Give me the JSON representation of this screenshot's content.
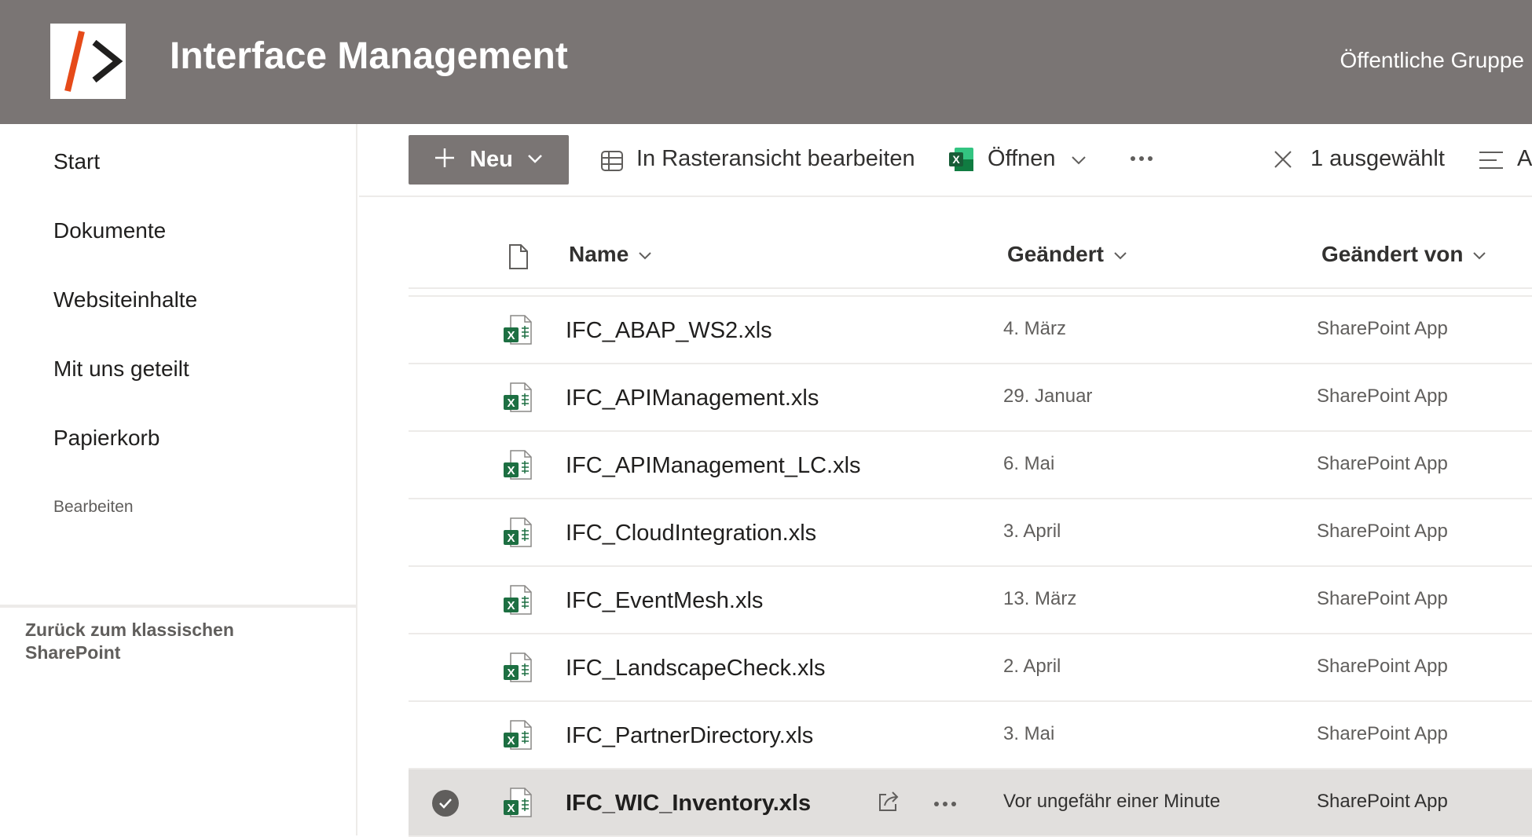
{
  "header": {
    "title": "Interface Management",
    "group_label": "Öffentliche Gruppe",
    "logo_icon": "site-logo-slash-chevron",
    "brand_color": "#7a7574",
    "logo_accent_color": "#e64a19"
  },
  "nav": {
    "items": [
      {
        "label": "Start"
      },
      {
        "label": "Dokumente"
      },
      {
        "label": "Websiteinhalte"
      },
      {
        "label": "Mit uns geteilt"
      },
      {
        "label": "Papierkorb"
      }
    ],
    "edit_label": "Bearbeiten",
    "classic_link": "Zurück zum klassischen SharePoint"
  },
  "commandbar": {
    "new_label": "Neu",
    "grid_edit_label": "In Rasteransicht bearbeiten",
    "open_label": "Öffnen",
    "more_icon": "ellipsis-icon",
    "selected_label": "1 ausgewählt",
    "view_label": "Al"
  },
  "columns": {
    "type_icon": "document-icon",
    "name": "Name",
    "modified": "Geändert",
    "modified_by": "Geändert von"
  },
  "files": [
    {
      "name": "IFC_ABAP_WS2.xls",
      "modified": "4. März",
      "modified_by": "SharePoint App",
      "selected": false
    },
    {
      "name": "IFC_APIManagement.xls",
      "modified": "29. Januar",
      "modified_by": "SharePoint App",
      "selected": false
    },
    {
      "name": "IFC_APIManagement_LC.xls",
      "modified": "6. Mai",
      "modified_by": "SharePoint App",
      "selected": false
    },
    {
      "name": "IFC_CloudIntegration.xls",
      "modified": "3. April",
      "modified_by": "SharePoint App",
      "selected": false
    },
    {
      "name": "IFC_EventMesh.xls",
      "modified": "13. März",
      "modified_by": "SharePoint App",
      "selected": false
    },
    {
      "name": "IFC_LandscapeCheck.xls",
      "modified": "2. April",
      "modified_by": "SharePoint App",
      "selected": false
    },
    {
      "name": "IFC_PartnerDirectory.xls",
      "modified": "3. Mai",
      "modified_by": "SharePoint App",
      "selected": false
    },
    {
      "name": "IFC_WIC_Inventory.xls",
      "modified": "Vor ungefähr einer Minute",
      "modified_by": "SharePoint App",
      "selected": true
    }
  ],
  "colors": {
    "excel_green": "#1d6f42",
    "selected_row": "#e1dfdd"
  }
}
